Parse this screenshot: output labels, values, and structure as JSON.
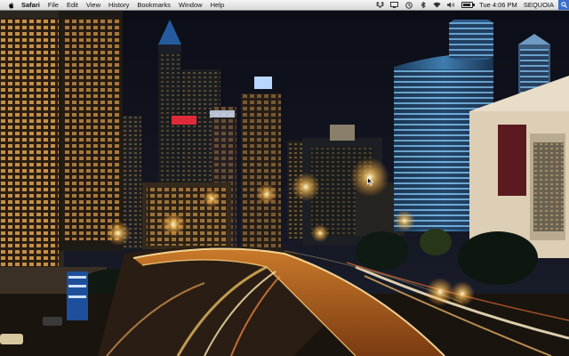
{
  "menubar": {
    "app_name": "Safari",
    "menus": [
      "File",
      "Edit",
      "View",
      "History",
      "Bookmarks",
      "Window",
      "Help"
    ],
    "status": {
      "icons": [
        "dropbox-icon",
        "display-icon",
        "timemachine-icon",
        "bluetooth-icon",
        "wifi-icon",
        "volume-icon",
        "battery-icon"
      ],
      "clock": "Tue 4:06 PM",
      "user": "SEQUOIA"
    }
  },
  "wallpaper": {
    "description_colors": {
      "sky": "#0f1220",
      "light": "#ffcf6a",
      "road": "#ffb347"
    }
  }
}
